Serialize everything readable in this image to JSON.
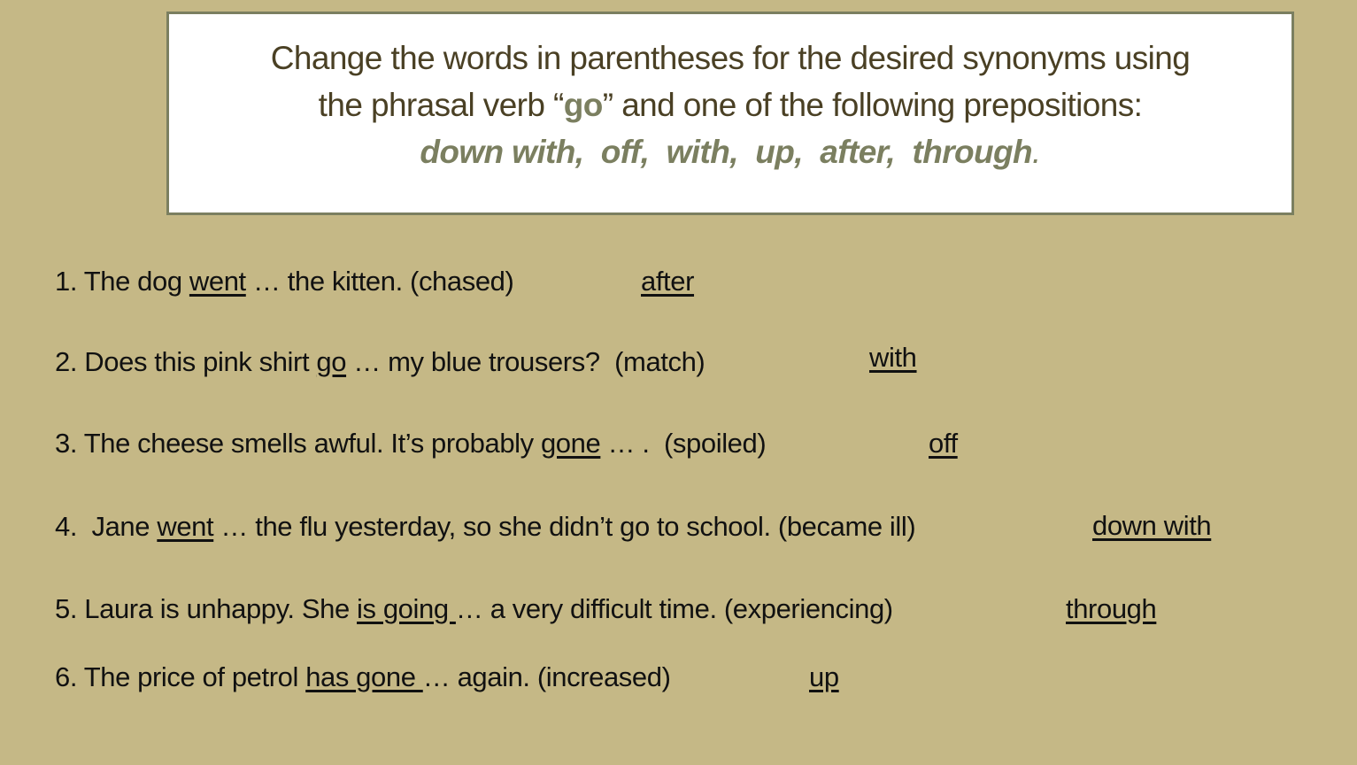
{
  "instructions": {
    "line1": "Change the words in parentheses for the desired synonyms using",
    "line2_before": "the phrasal verb “",
    "line2_verb": "go",
    "line2_after": "” and one of the following prepositions:",
    "prepositions_text": "down with,  off,  with,  up,  after,  through",
    "prepositions_end": "."
  },
  "exercises": [
    {
      "number": "1. ",
      "before": "The dog ",
      "underlined": "went",
      "after": " … the kitten. (chased)",
      "answer": "after"
    },
    {
      "number": "2. ",
      "before": "Does this pink shirt ",
      "underlined": "go",
      "after": " … my blue trousers?  (match)",
      "answer": "with"
    },
    {
      "number": "3. ",
      "before": "The cheese smells awful. It’s probably ",
      "underlined": "gone",
      "after": " … .  (spoiled)",
      "answer": "off"
    },
    {
      "number": "4.  ",
      "before": "Jane ",
      "underlined": "went",
      "after": " … the flu yesterday, so she didn’t go to school. (became ill)",
      "answer": "down with"
    },
    {
      "number": "5. ",
      "before": "Laura is unhappy. She ",
      "underlined": "is going ",
      "after": "… a very difficult time. (experiencing)",
      "answer": "through"
    },
    {
      "number": "6. ",
      "before": "The price of petrol ",
      "underlined": "has gone ",
      "after": "… again. (increased)",
      "answer": "up"
    }
  ],
  "colors": {
    "background": "#c5b886",
    "accent": "#7b7f60",
    "instruction_text": "#4a4024",
    "body_text": "#111111"
  }
}
